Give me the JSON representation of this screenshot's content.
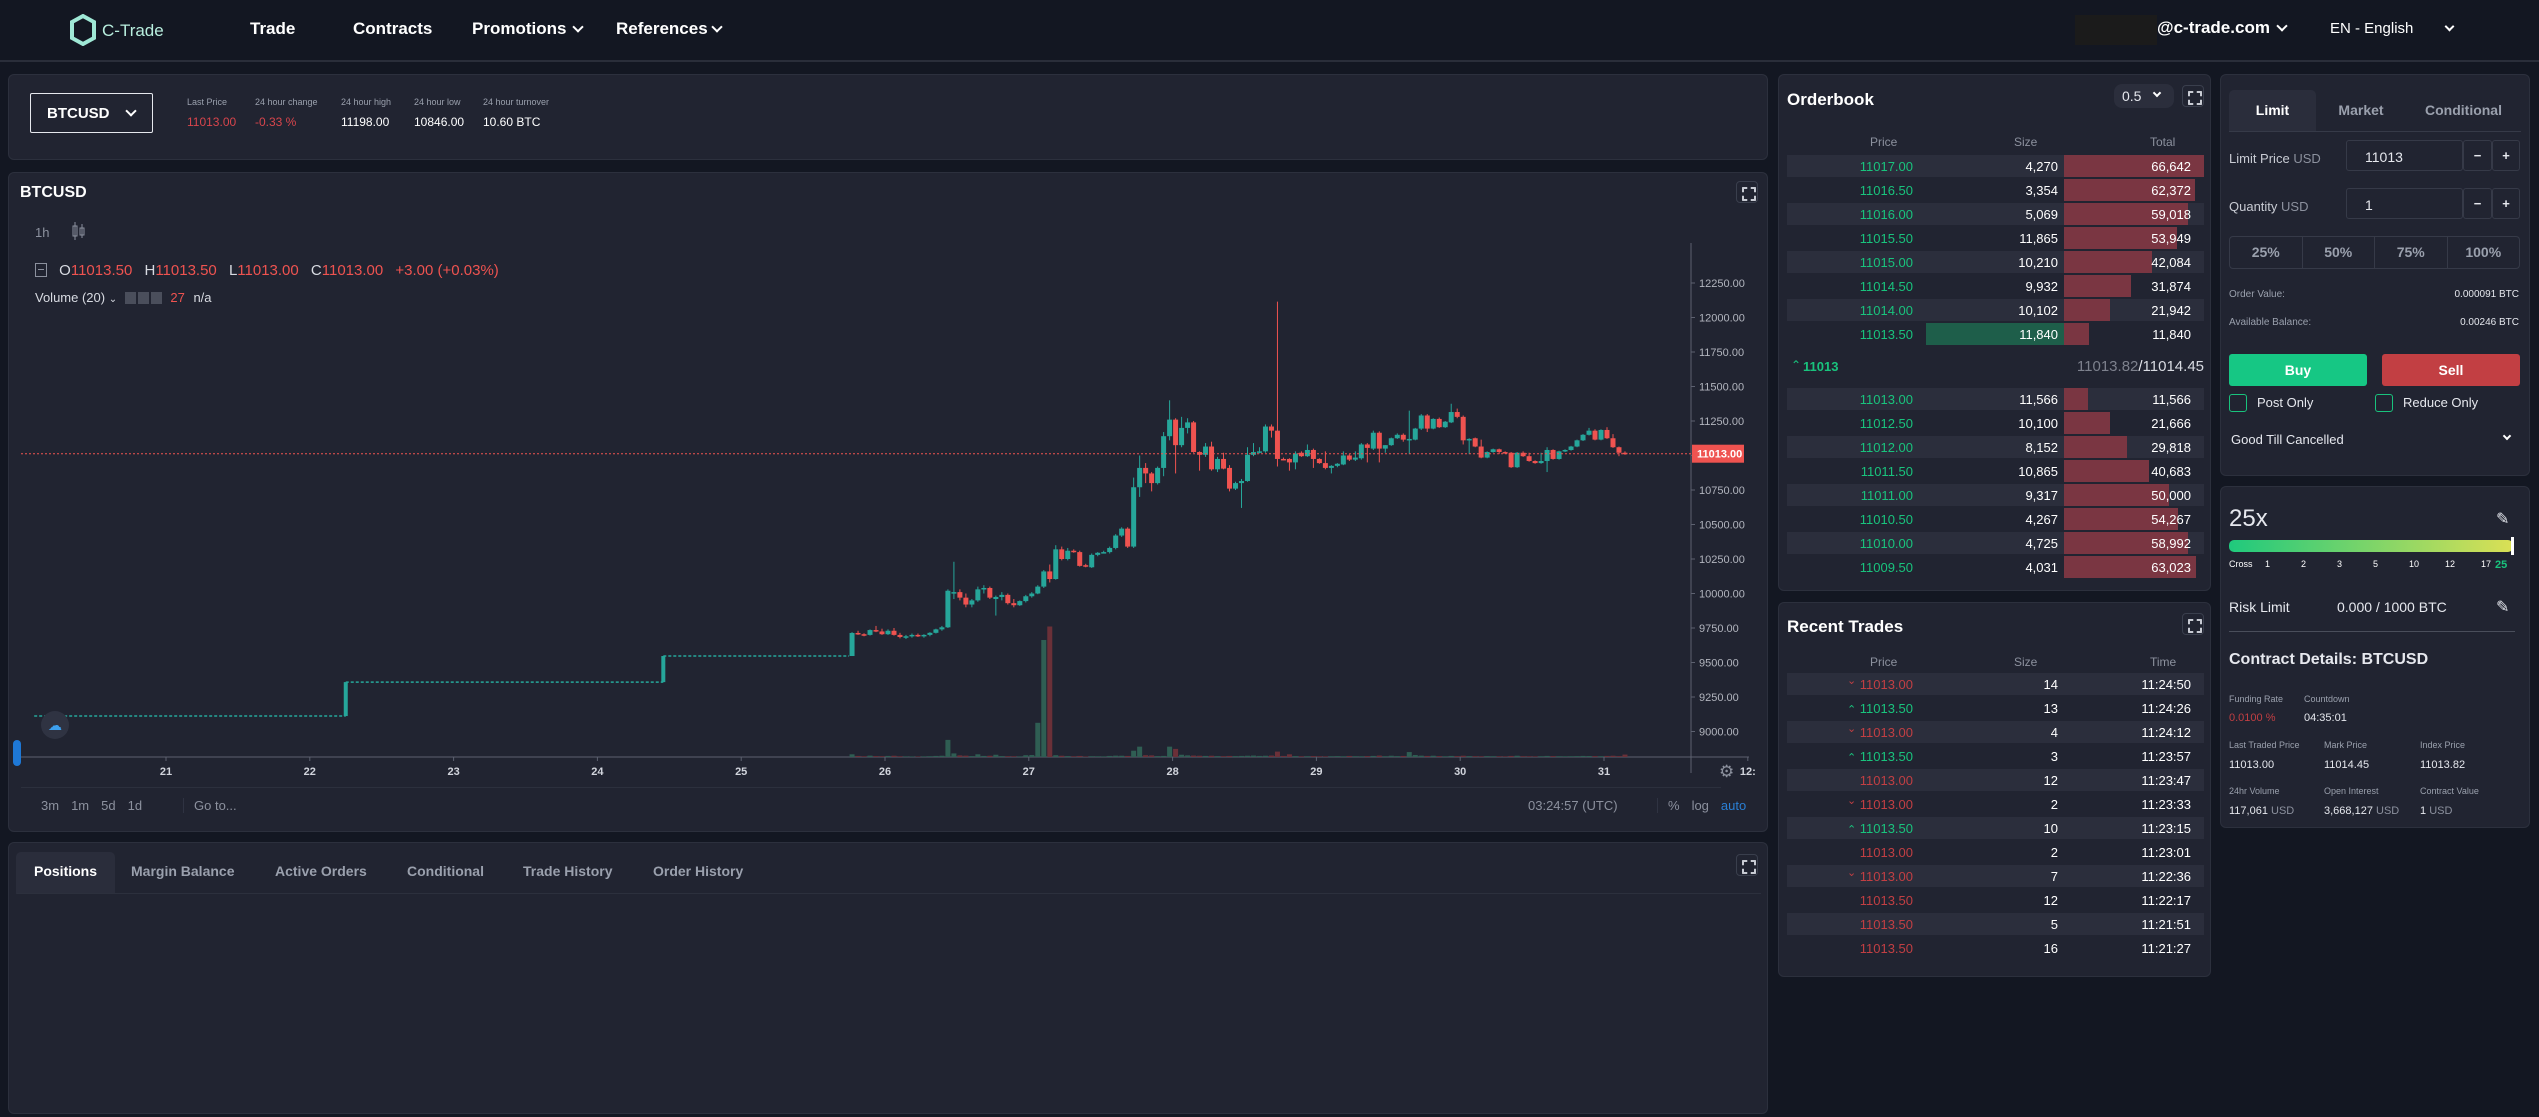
{
  "header": {
    "logo": "C-Trade",
    "nav": [
      {
        "label": "Trade"
      },
      {
        "label": "Contracts"
      },
      {
        "label": "Promotions",
        "dropdown": true
      },
      {
        "label": "References",
        "dropdown": true
      }
    ],
    "account": "@c-trade.com",
    "language": "EN - English"
  },
  "ticker": {
    "symbol": "BTCUSD",
    "stats": [
      {
        "label": "Last Price",
        "value": "11013.00",
        "color": "red"
      },
      {
        "label": "24 hour change",
        "value": "-0.33 %",
        "color": "red"
      },
      {
        "label": "24 hour high",
        "value": "11198.00",
        "color": "white"
      },
      {
        "label": "24 hour low",
        "value": "10846.00",
        "color": "white"
      },
      {
        "label": "24 hour turnover",
        "value": "10.60 BTC",
        "color": "white"
      }
    ]
  },
  "chart": {
    "title": "BTCUSD",
    "interval": "1h",
    "legend": {
      "o_label": "O",
      "o": "11013.50",
      "h_label": "H",
      "h": "11013.50",
      "l_label": "L",
      "l": "11013.00",
      "c_label": "C",
      "c": "11013.00",
      "change": "+3.00 (+0.03%)"
    },
    "volume_label": "Volume (20)",
    "volume_value": "27",
    "volume_extra": "n/a",
    "ranges": [
      "3m",
      "1m",
      "5d",
      "1d"
    ],
    "goto": "Go to...",
    "clock": "03:24:57 (UTC)",
    "scale_options": [
      "%",
      "log",
      "auto"
    ],
    "active_scale": "auto"
  },
  "chart_data": {
    "type": "candlestick",
    "interval": "1h",
    "price_ticks": [
      "12250.00",
      "12000.00",
      "11750.00",
      "11500.00",
      "11250.00",
      "11000.00",
      "10750.00",
      "10500.00",
      "10250.00",
      "10000.00",
      "9750.00",
      "9500.00",
      "9250.00",
      "9000.00"
    ],
    "ylim": [
      8850,
      12300
    ],
    "time_ticks": [
      "21",
      "22",
      "23",
      "24",
      "25",
      "26",
      "27",
      "28",
      "29",
      "30",
      "31",
      "12:"
    ],
    "last_price": 11013.0,
    "last_price_label": "11013.00",
    "up_color": "#26a69a",
    "down_color": "#ef5350",
    "sparse_prices": [
      [
        "20 02:00",
        9112
      ],
      [
        "22 06:00",
        9358
      ],
      [
        "24 11:00",
        9547
      ]
    ],
    "candles_start": "25 18:00",
    "candles": [
      [
        9547,
        9720,
        9547,
        9714,
        30
      ],
      [
        9714,
        9730,
        9700,
        9705,
        12
      ],
      [
        9705,
        9712,
        9690,
        9700,
        8
      ],
      [
        9700,
        9740,
        9695,
        9735,
        15
      ],
      [
        9735,
        9765,
        9720,
        9725,
        10
      ],
      [
        9725,
        9745,
        9700,
        9705,
        9
      ],
      [
        9705,
        9740,
        9700,
        9730,
        12
      ],
      [
        9730,
        9750,
        9695,
        9700,
        14
      ],
      [
        9700,
        9715,
        9675,
        9685,
        8
      ],
      [
        9685,
        9700,
        9670,
        9690,
        7
      ],
      [
        9690,
        9710,
        9680,
        9700,
        6
      ],
      [
        9700,
        9710,
        9685,
        9690,
        6
      ],
      [
        9690,
        9705,
        9680,
        9700,
        7
      ],
      [
        9700,
        9720,
        9690,
        9715,
        9
      ],
      [
        9715,
        9745,
        9710,
        9740,
        12
      ],
      [
        9740,
        9765,
        9730,
        9755,
        14
      ],
      [
        9755,
        10030,
        9750,
        10020,
        190
      ],
      [
        10010,
        10230,
        9960,
        10010,
        40
      ],
      [
        10010,
        10030,
        9950,
        9970,
        18
      ],
      [
        9970,
        10000,
        9900,
        9920,
        15
      ],
      [
        9920,
        9960,
        9900,
        9950,
        10
      ],
      [
        9950,
        10050,
        9940,
        10030,
        30
      ],
      [
        10030,
        10060,
        10000,
        10040,
        12
      ],
      [
        10040,
        10050,
        9960,
        9970,
        14
      ],
      [
        9960,
        9985,
        9840,
        9975,
        25
      ],
      [
        9975,
        10010,
        9950,
        9990,
        10
      ],
      [
        9990,
        10000,
        9920,
        9930,
        9
      ],
      [
        9930,
        9960,
        9900,
        9915,
        8
      ],
      [
        9915,
        9950,
        9910,
        9945,
        7
      ],
      [
        9945,
        9990,
        9935,
        9980,
        20
      ],
      [
        9980,
        10010,
        9970,
        10000,
        22
      ],
      [
        10000,
        10060,
        9995,
        10050,
        380
      ],
      [
        10050,
        10170,
        10040,
        10160,
        1300
      ],
      [
        10160,
        10210,
        10080,
        10105,
        1450
      ],
      [
        10105,
        10350,
        10100,
        10320,
        20
      ],
      [
        10320,
        10340,
        10240,
        10250,
        14
      ],
      [
        10250,
        10330,
        10240,
        10310,
        10
      ],
      [
        10310,
        10320,
        10295,
        10300,
        8
      ],
      [
        10300,
        10310,
        10195,
        10200,
        12
      ],
      [
        10205,
        10215,
        10190,
        10195,
        6
      ],
      [
        10190,
        10290,
        10185,
        10280,
        9
      ],
      [
        10280,
        10300,
        10270,
        10295,
        8
      ],
      [
        10295,
        10310,
        10290,
        10300,
        7
      ],
      [
        10300,
        10340,
        10290,
        10330,
        12
      ],
      [
        10330,
        10430,
        10320,
        10420,
        15
      ],
      [
        10420,
        10480,
        10410,
        10470,
        14
      ],
      [
        10470,
        10480,
        10330,
        10340,
        12
      ],
      [
        10340,
        10840,
        10330,
        10770,
        70
      ],
      [
        10770,
        11000,
        10700,
        10910,
        115
      ],
      [
        10910,
        10945,
        10800,
        10870,
        20
      ],
      [
        10870,
        10880,
        10740,
        10800,
        18
      ],
      [
        10800,
        10920,
        10790,
        10910,
        10
      ],
      [
        10910,
        11170,
        10850,
        11140,
        12
      ],
      [
        11140,
        11400,
        11110,
        11260,
        115
      ],
      [
        11260,
        11270,
        10870,
        11075,
        90
      ],
      [
        11075,
        11280,
        11060,
        11200,
        25
      ],
      [
        11200,
        11270,
        11160,
        11240,
        18
      ],
      [
        11240,
        11250,
        11020,
        11025,
        16
      ],
      [
        11025,
        11030,
        10890,
        11005,
        14
      ],
      [
        11005,
        11090,
        10990,
        11065,
        12
      ],
      [
        11065,
        11100,
        10890,
        10900,
        14
      ],
      [
        10900,
        10990,
        10880,
        10975,
        10
      ],
      [
        10975,
        11020,
        10900,
        10905,
        9
      ],
      [
        10910,
        10930,
        10740,
        10760,
        12
      ],
      [
        10760,
        10810,
        10750,
        10800,
        10
      ],
      [
        10800,
        10830,
        10620,
        10815,
        12
      ],
      [
        10815,
        11060,
        10810,
        11005,
        14
      ],
      [
        11005,
        11090,
        10995,
        11025,
        16
      ],
      [
        11025,
        11060,
        11015,
        11030,
        12
      ],
      [
        11030,
        11225,
        11020,
        11210,
        14
      ],
      [
        11210,
        11225,
        11130,
        11180,
        16
      ],
      [
        11180,
        12115,
        10920,
        10975,
        60
      ],
      [
        10975,
        10985,
        10965,
        10970,
        12
      ],
      [
        10975,
        10980,
        10890,
        10950,
        30
      ],
      [
        10950,
        11030,
        10900,
        11015,
        10
      ],
      [
        11020,
        11030,
        10990,
        10995,
        8
      ],
      [
        10995,
        11080,
        10990,
        11040,
        9
      ],
      [
        11040,
        11050,
        10910,
        10975,
        10
      ],
      [
        10975,
        10980,
        10940,
        10945,
        8
      ],
      [
        10945,
        11030,
        10900,
        10910,
        7
      ],
      [
        10910,
        10930,
        10870,
        10925,
        9
      ],
      [
        10925,
        10945,
        10915,
        10940,
        10
      ],
      [
        10935,
        11030,
        10930,
        11000,
        8
      ],
      [
        11000,
        11010,
        10960,
        10970,
        12
      ],
      [
        10970,
        11030,
        10960,
        10985,
        9
      ],
      [
        10980,
        11090,
        10970,
        11080,
        8
      ],
      [
        11080,
        11090,
        10950,
        11055,
        10
      ],
      [
        11050,
        11180,
        11040,
        11165,
        12
      ],
      [
        11165,
        11175,
        10950,
        11050,
        16
      ],
      [
        11050,
        11075,
        11020,
        11075,
        9
      ],
      [
        11075,
        11130,
        11070,
        11125,
        14
      ],
      [
        11125,
        11160,
        11120,
        11150,
        10
      ],
      [
        11150,
        11160,
        11100,
        11115,
        12
      ],
      [
        11115,
        11325,
        11010,
        11120,
        55
      ],
      [
        11115,
        11200,
        11110,
        11195,
        22
      ],
      [
        11195,
        11300,
        11185,
        11290,
        15
      ],
      [
        11290,
        11300,
        11170,
        11195,
        12
      ],
      [
        11195,
        11270,
        11190,
        11265,
        14
      ],
      [
        11265,
        11275,
        11200,
        11205,
        10
      ],
      [
        11205,
        11250,
        11200,
        11245,
        8
      ],
      [
        11240,
        11375,
        11235,
        11315,
        12
      ],
      [
        11315,
        11340,
        11270,
        11280,
        10
      ],
      [
        11280,
        11290,
        11080,
        11110,
        14
      ],
      [
        11110,
        11125,
        11010,
        11120,
        10
      ],
      [
        11125,
        11130,
        11060,
        11065,
        9
      ],
      [
        11065,
        11115,
        10980,
        10985,
        8
      ],
      [
        10985,
        11030,
        10980,
        11025,
        10
      ],
      [
        11025,
        11050,
        11020,
        11045,
        9
      ],
      [
        11045,
        11050,
        11010,
        11025,
        8
      ],
      [
        11025,
        11030,
        11015,
        11020,
        7
      ],
      [
        11020,
        11025,
        10910,
        10915,
        12
      ],
      [
        10915,
        11025,
        10910,
        11020,
        14
      ],
      [
        11020,
        11030,
        10990,
        10995,
        9
      ],
      [
        10995,
        11020,
        10955,
        10960,
        8
      ],
      [
        10960,
        10965,
        10940,
        10945,
        7
      ],
      [
        10945,
        11020,
        10940,
        10960,
        9
      ],
      [
        10960,
        11060,
        10880,
        11040,
        12
      ],
      [
        11040,
        11045,
        10970,
        10975,
        10
      ],
      [
        10975,
        11035,
        10970,
        11030,
        9
      ],
      [
        11030,
        11045,
        11025,
        11040,
        8
      ],
      [
        11040,
        11070,
        11035,
        11065,
        9
      ],
      [
        11065,
        11115,
        11060,
        11110,
        10
      ],
      [
        11110,
        11155,
        11105,
        11150,
        12
      ],
      [
        11150,
        11200,
        11145,
        11180,
        11
      ],
      [
        11180,
        11190,
        11110,
        11115,
        10
      ],
      [
        11115,
        11190,
        11110,
        11185,
        9
      ],
      [
        11185,
        11205,
        11120,
        11125,
        12
      ],
      [
        11125,
        11155,
        11055,
        11060,
        14
      ],
      [
        11060,
        11065,
        10995,
        11020,
        10
      ],
      [
        11020,
        11030,
        11005,
        11013,
        27
      ]
    ]
  },
  "orderbook": {
    "title": "Orderbook",
    "step": "0.5",
    "headers": [
      "Price",
      "Size",
      "Total"
    ],
    "asks": [
      {
        "price": "11017.00",
        "size": "4,270",
        "total": "66,642",
        "t": 66642
      },
      {
        "price": "11016.50",
        "size": "3,354",
        "total": "62,372",
        "t": 62372
      },
      {
        "price": "11016.00",
        "size": "5,069",
        "total": "59,018",
        "t": 59018
      },
      {
        "price": "11015.50",
        "size": "11,865",
        "total": "53,949",
        "t": 53949
      },
      {
        "price": "11015.00",
        "size": "10,210",
        "total": "42,084",
        "t": 42084
      },
      {
        "price": "11014.50",
        "size": "9,932",
        "total": "31,874",
        "t": 31874
      },
      {
        "price": "11014.00",
        "size": "10,102",
        "total": "21,942",
        "t": 21942
      },
      {
        "price": "11013.50",
        "size": "11,840",
        "total": "11,840",
        "t": 11840,
        "size_highlight": true
      }
    ],
    "mid": {
      "last": "11013",
      "index": "11013.82",
      "mark": "11014.45"
    },
    "bids": [
      {
        "price": "11013.00",
        "size": "11,566",
        "total": "11,566",
        "t": 11566
      },
      {
        "price": "11012.50",
        "size": "10,100",
        "total": "21,666",
        "t": 21666
      },
      {
        "price": "11012.00",
        "size": "8,152",
        "total": "29,818",
        "t": 29818
      },
      {
        "price": "11011.50",
        "size": "10,865",
        "total": "40,683",
        "t": 40683
      },
      {
        "price": "11011.00",
        "size": "9,317",
        "total": "50,000",
        "t": 50000
      },
      {
        "price": "11010.50",
        "size": "4,267",
        "total": "54,267",
        "t": 54267
      },
      {
        "price": "11010.00",
        "size": "4,725",
        "total": "58,992",
        "t": 58992
      },
      {
        "price": "11009.50",
        "size": "4,031",
        "total": "63,023",
        "t": 63023
      }
    ]
  },
  "recent_trades": {
    "title": "Recent Trades",
    "headers": [
      "Price",
      "Size",
      "Time"
    ],
    "rows": [
      {
        "price": "11013.00",
        "size": "14",
        "time": "11:24:50",
        "side": "sell",
        "arrow": "down"
      },
      {
        "price": "11013.50",
        "size": "13",
        "time": "11:24:26",
        "side": "buy",
        "arrow": "up"
      },
      {
        "price": "11013.00",
        "size": "4",
        "time": "11:24:12",
        "side": "sell",
        "arrow": "down"
      },
      {
        "price": "11013.50",
        "size": "3",
        "time": "11:23:57",
        "side": "buy",
        "arrow": "up"
      },
      {
        "price": "11013.00",
        "size": "12",
        "time": "11:23:47",
        "side": "sell",
        "arrow": ""
      },
      {
        "price": "11013.00",
        "size": "2",
        "time": "11:23:33",
        "side": "sell",
        "arrow": "down"
      },
      {
        "price": "11013.50",
        "size": "10",
        "time": "11:23:15",
        "side": "buy",
        "arrow": "up"
      },
      {
        "price": "11013.00",
        "size": "2",
        "time": "11:23:01",
        "side": "sell",
        "arrow": ""
      },
      {
        "price": "11013.00",
        "size": "7",
        "time": "11:22:36",
        "side": "sell",
        "arrow": "down"
      },
      {
        "price": "11013.50",
        "size": "12",
        "time": "11:22:17",
        "side": "sell",
        "arrow": ""
      },
      {
        "price": "11013.50",
        "size": "5",
        "time": "11:21:51",
        "side": "sell",
        "arrow": ""
      },
      {
        "price": "11013.50",
        "size": "16",
        "time": "11:21:27",
        "side": "sell",
        "arrow": ""
      }
    ]
  },
  "order_form": {
    "tabs": [
      "Limit",
      "Market",
      "Conditional"
    ],
    "active_tab": "Limit",
    "limit_price_label": "Limit Price",
    "limit_price_unit": "USD",
    "limit_price": "11013",
    "quantity_label": "Quantity",
    "quantity_unit": "USD",
    "quantity": "1",
    "minus": "−",
    "plus": "+",
    "percents": [
      "25%",
      "50%",
      "75%",
      "100%"
    ],
    "order_value_label": "Order Value:",
    "order_value": "0.000091 BTC",
    "available_label": "Available Balance:",
    "available": "0.00246 BTC",
    "buy": "Buy",
    "sell": "Sell",
    "post_only": "Post Only",
    "reduce_only": "Reduce Only",
    "post_only_checked": false,
    "reduce_only_checked": false,
    "time_in_force": "Good Till Cancelled"
  },
  "leverage": {
    "value": "25x",
    "level": 25,
    "ticks": [
      "Cross",
      "1",
      "2",
      "3",
      "5",
      "10",
      "12",
      "17",
      "25"
    ],
    "risk_label": "Risk Limit",
    "risk_value": "0.000 / 1000 BTC"
  },
  "contract": {
    "title": "Contract Details: BTCUSD",
    "funding_label": "Funding Rate",
    "funding": "0.0100 %",
    "countdown_label": "Countdown",
    "countdown": "04:35:01",
    "fields": [
      {
        "label": "Last Traded Price",
        "value": "11013.00",
        "unit": ""
      },
      {
        "label": "Mark Price",
        "value": "11014.45",
        "unit": ""
      },
      {
        "label": "Index Price",
        "value": "11013.82",
        "unit": ""
      },
      {
        "label": "24hr Volume",
        "value": "117,061",
        "unit": "USD"
      },
      {
        "label": "Open Interest",
        "value": "3,668,127",
        "unit": "USD"
      },
      {
        "label": "Contract Value",
        "value": "1",
        "unit": "USD"
      }
    ]
  },
  "bottom_tabs": {
    "tabs": [
      "Positions",
      "Margin Balance",
      "Active Orders",
      "Conditional",
      "Trade History",
      "Order History"
    ],
    "active": "Positions"
  },
  "colors": {
    "up": "#19c37d",
    "down": "#d8454c",
    "accent": "#2a7fd4"
  }
}
